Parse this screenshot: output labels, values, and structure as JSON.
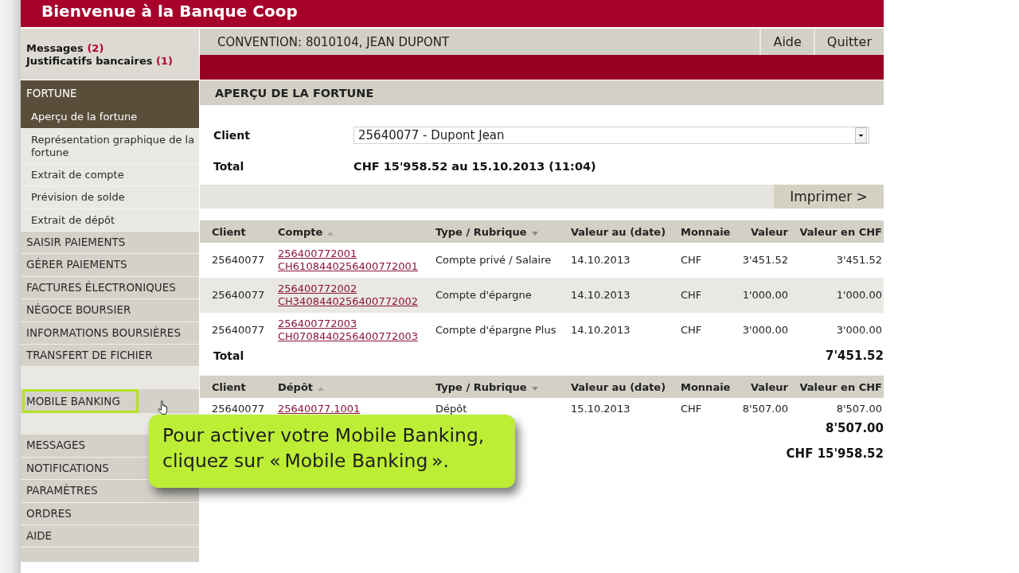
{
  "header": {
    "title": "Bienvenue à la Banque Coop"
  },
  "sidebar": {
    "notices": [
      {
        "label": "Messages",
        "count": "(2)"
      },
      {
        "label": "Justificatifs bancaires",
        "count": "(1)"
      }
    ],
    "nav_groups": [
      {
        "items": [
          {
            "label": "FORTUNE",
            "expanded": true,
            "highlighted": false,
            "children": [
              {
                "label": "Aperçu de la fortune",
                "selected": true
              },
              {
                "label": "Représentation graphique de la fortune",
                "selected": false
              },
              {
                "label": "Extrait de compte",
                "selected": false
              },
              {
                "label": "Prévision de solde",
                "selected": false
              },
              {
                "label": "Extrait de dépôt",
                "selected": false
              }
            ]
          },
          {
            "label": "SAISIR PAIEMENTS",
            "expanded": false,
            "highlighted": false
          },
          {
            "label": "GÉRER PAIEMENTS",
            "expanded": false,
            "highlighted": false
          },
          {
            "label": "FACTURES ÉLECTRONIQUES",
            "expanded": false,
            "highlighted": false
          },
          {
            "label": "NÉGOCE BOURSIER",
            "expanded": false,
            "highlighted": false
          },
          {
            "label": "INFORMATIONS BOURSIÈRES",
            "expanded": false,
            "highlighted": false
          },
          {
            "label": "TRANSFERT DE FICHIER",
            "expanded": false,
            "highlighted": false
          }
        ]
      },
      {
        "items": [
          {
            "label": "MOBILE BANKING",
            "expanded": false,
            "highlighted": true
          }
        ]
      },
      {
        "items": [
          {
            "label": "MESSAGES",
            "expanded": false,
            "highlighted": false
          },
          {
            "label": "NOTIFICATIONS",
            "expanded": false,
            "highlighted": false
          },
          {
            "label": "PARAMÈTRES",
            "expanded": false,
            "highlighted": false
          },
          {
            "label": "ORDRES",
            "expanded": false,
            "highlighted": false
          },
          {
            "label": "AIDE",
            "expanded": false,
            "highlighted": false
          }
        ]
      }
    ]
  },
  "account_bar": {
    "convention": "CONVENTION: 8010104, JEAN DUPONT",
    "buttons": [
      "Aide",
      "Quitter"
    ]
  },
  "page_title": "APERÇU DE LA FORTUNE",
  "summary": {
    "client_label": "Client",
    "client_select": {
      "value": "25640077 - Dupont Jean"
    },
    "total_label": "Total",
    "total_value": "CHF 15'958.52 au 15.10.2013 (11:04)"
  },
  "print_button": "Imprimer >",
  "tables": [
    {
      "columns": [
        {
          "label": "Client",
          "sorted_ascending": false,
          "sorted_descending": false
        },
        {
          "label": "Compte",
          "sorted_ascending": true,
          "sorted_descending": false
        },
        {
          "label": "Type / Rubrique",
          "sorted_ascending": false,
          "sorted_descending": true
        },
        {
          "label": "Valeur au (date)",
          "sorted_ascending": false,
          "sorted_descending": false
        },
        {
          "label": "Monnaie",
          "sorted_ascending": false,
          "sorted_descending": false
        },
        {
          "label": "Valeur",
          "sorted_ascending": false,
          "sorted_descending": false
        },
        {
          "label": "Valeur en CHF",
          "sorted_ascending": false,
          "sorted_descending": false
        }
      ],
      "rows": [
        {
          "client": "25640077",
          "account": "256400772001",
          "iban": "CH6108440256400772001",
          "type": "Compte privé / Salaire",
          "date": "14.10.2013",
          "currency": "CHF",
          "value": "3'451.52",
          "value_chf": "3'451.52"
        },
        {
          "client": "25640077",
          "account": "256400772002",
          "iban": "CH3408440256400772002",
          "type": "Compte d'épargne",
          "date": "14.10.2013",
          "currency": "CHF",
          "value": "1'000.00",
          "value_chf": "1'000.00"
        },
        {
          "client": "25640077",
          "account": "256400772003",
          "iban": "CH0708440256400772003",
          "type": "Compte d'épargne Plus",
          "date": "14.10.2013",
          "currency": "CHF",
          "value": "3'000.00",
          "value_chf": "3'000.00"
        }
      ],
      "total_label": "Total",
      "total": "7'451.52"
    },
    {
      "columns": [
        {
          "label": "Client",
          "sorted_ascending": false,
          "sorted_descending": false
        },
        {
          "label": "Dépôt",
          "sorted_ascending": true,
          "sorted_descending": false
        },
        {
          "label": "Type / Rubrique",
          "sorted_ascending": false,
          "sorted_descending": true
        },
        {
          "label": "Valeur au (date)",
          "sorted_ascending": false,
          "sorted_descending": false
        },
        {
          "label": "Monnaie",
          "sorted_ascending": false,
          "sorted_descending": false
        },
        {
          "label": "Valeur",
          "sorted_ascending": false,
          "sorted_descending": false
        },
        {
          "label": "Valeur en CHF",
          "sorted_ascending": false,
          "sorted_descending": false
        }
      ],
      "rows": [
        {
          "client": "25640077",
          "account": "25640077.1001",
          "type": "Dépôt",
          "date": "15.10.2013",
          "currency": "CHF",
          "value": "8'507.00",
          "value_chf": "8'507.00"
        }
      ],
      "total": "8'507.00"
    }
  ],
  "grand_total": "CHF 15'958.52",
  "callout": {
    "text": "Pour activer votre Mobile Banking,\ncliquez sur « Mobile Banking »."
  }
}
